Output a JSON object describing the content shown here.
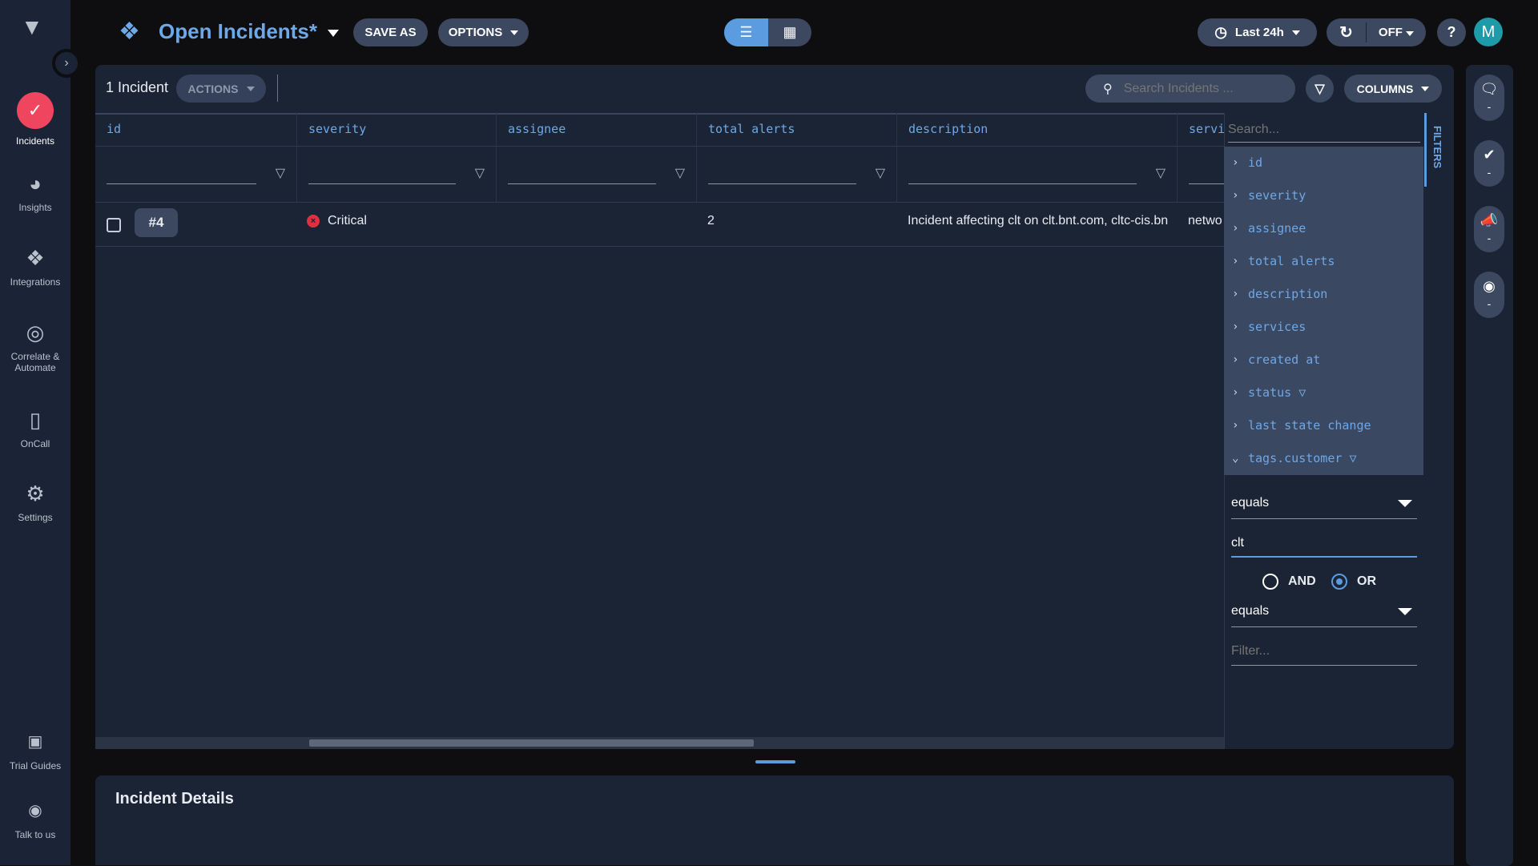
{
  "sidebar": {
    "items": [
      {
        "label": "Incidents",
        "icon": "incidents-icon"
      },
      {
        "label": "Insights",
        "icon": "pie-chart-icon"
      },
      {
        "label": "Integrations",
        "icon": "integrations-icon"
      },
      {
        "label": "Correlate &",
        "label2": "Automate",
        "icon": "radar-icon"
      },
      {
        "label": "OnCall",
        "icon": "phone-icon"
      },
      {
        "label": "Settings",
        "icon": "gear-icon"
      },
      {
        "label": "Trial Guides",
        "icon": "book-icon"
      },
      {
        "label": "Talk to us",
        "icon": "headset-icon"
      }
    ],
    "accent": "#f0455e"
  },
  "header": {
    "title": "Open Incidents",
    "modified_marker": "*",
    "save_as": "SAVE AS",
    "options": "OPTIONS",
    "time_range": "Last 24h",
    "refresh": "OFF",
    "help": "?",
    "avatar": "M",
    "title_color": "#6ea8e6",
    "avatar_color": "#1e9aa8"
  },
  "toolbar": {
    "count": "1 Incident",
    "actions": "ACTIONS",
    "search_placeholder": "Search Incidents ...",
    "columns": "COLUMNS"
  },
  "table": {
    "columns": [
      "id",
      "severity",
      "assignee",
      "total alerts",
      "description",
      "servi"
    ],
    "rows": [
      {
        "id": "#4",
        "severity": "Critical",
        "assignee": "",
        "total_alerts": "2",
        "description": "Incident affecting clt on clt.bnt.com, cltc-cis.bn",
        "services": "netwo"
      }
    ]
  },
  "filters": {
    "tab": "FILTERS",
    "search_placeholder": "Search...",
    "fields": [
      "id",
      "severity",
      "assignee",
      "total alerts",
      "description",
      "services",
      "created at",
      "status",
      "last state change",
      "tags.customer"
    ],
    "active_filter_fields": [
      "status",
      "tags.customer"
    ],
    "expanded": "tags.customer",
    "operator1": "equals",
    "value1": "clt",
    "logic_and": "AND",
    "logic_or": "OR",
    "logic_selected": "OR",
    "operator2": "equals",
    "value2_placeholder": "Filter..."
  },
  "rail": {
    "items": [
      {
        "icon": "comments-icon",
        "value": "-"
      },
      {
        "icon": "badge-check-icon",
        "value": "-"
      },
      {
        "icon": "megaphone-icon",
        "value": "-"
      },
      {
        "icon": "eye-icon",
        "value": "-"
      }
    ]
  },
  "details": {
    "title": "Incident Details"
  }
}
